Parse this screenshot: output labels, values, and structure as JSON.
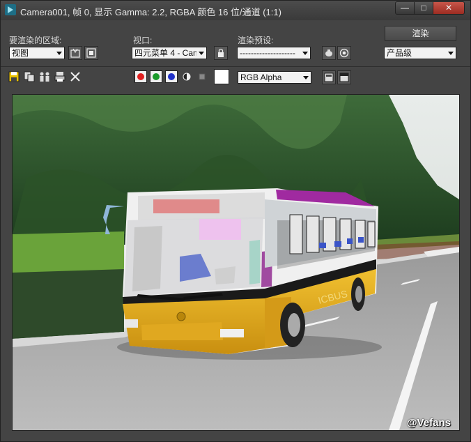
{
  "window": {
    "title": "Camera001, 帧 0, 显示 Gamma: 2.2, RGBA 颜色 16 位/通道 (1:1)",
    "minimize_label": "—",
    "maximize_label": "□",
    "close_label": "✕"
  },
  "area": {
    "label": "要渲染的区域:",
    "value": "视图"
  },
  "viewport_select": {
    "label": "视口:",
    "value": "四元菜单 4 - Can"
  },
  "preset": {
    "label": "渲染预设:",
    "value": "--------------------"
  },
  "render": {
    "button_label": "渲染",
    "quality_value": "产品级"
  },
  "channel": {
    "value": "RGB Alpha"
  },
  "colors": {
    "accent_red": "#e02020",
    "accent_green": "#1a9a2a",
    "accent_blue": "#2030c8",
    "bus_yellow": "#e8b420"
  },
  "watermark": "@Vefans"
}
